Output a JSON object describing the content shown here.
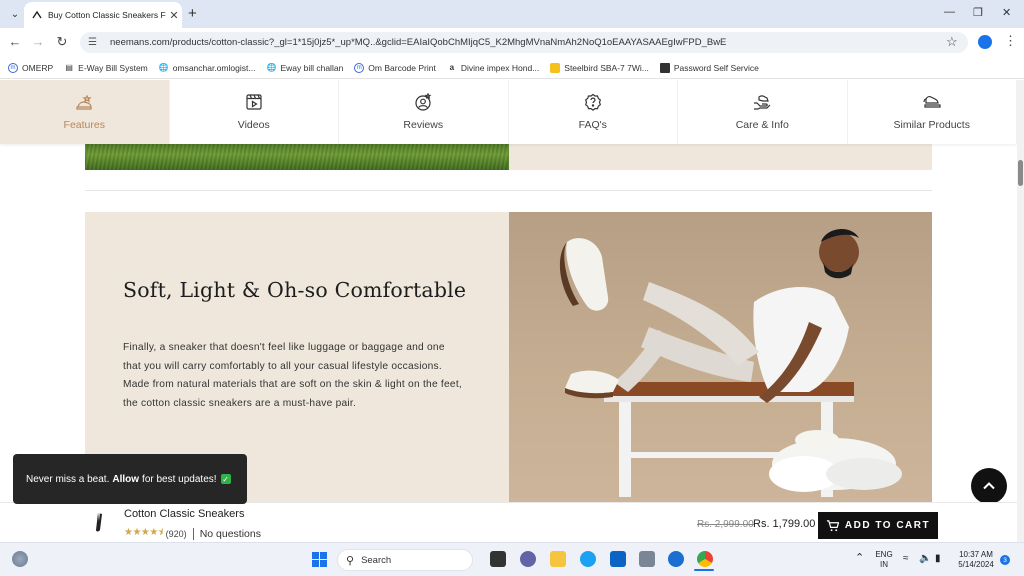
{
  "browser": {
    "tab_title": "Buy Cotton Classic Sneakers Fo",
    "url": "neemans.com/products/cotton-classic?_gl=1*15j0jz5*_up*MQ..&gclid=EAIaIQobChMIjqC5_K2MhgMVnaNmAh2NoQ1oEAAYASAAEgIwFPD_BwE",
    "bookmarks": [
      {
        "label": "OMERP",
        "icon": "omerp-icon"
      },
      {
        "label": "E-Way Bill System",
        "icon": "eway-icon"
      },
      {
        "label": "omsanchar.omlogist...",
        "icon": "globe-icon"
      },
      {
        "label": "Eway bill challan",
        "icon": "globe-icon"
      },
      {
        "label": "Om Barcode Print",
        "icon": "omerp-icon"
      },
      {
        "label": "Divine impex Hond...",
        "icon": "amazon-icon"
      },
      {
        "label": "Steelbird SBA-7 7Wi...",
        "icon": "steelbird-icon"
      },
      {
        "label": "Password Self Service",
        "icon": "pss-icon"
      }
    ]
  },
  "site_nav": {
    "tabs": [
      {
        "label": "Features",
        "icon": "features-icon",
        "active": true
      },
      {
        "label": "Videos",
        "icon": "videos-icon",
        "active": false
      },
      {
        "label": "Reviews",
        "icon": "reviews-icon",
        "active": false
      },
      {
        "label": "FAQ's",
        "icon": "faq-icon",
        "active": false
      },
      {
        "label": "Care & Info",
        "icon": "care-icon",
        "active": false
      },
      {
        "label": "Similar Products",
        "icon": "similar-icon",
        "active": false
      }
    ]
  },
  "feature": {
    "heading": "Soft, Light & Oh-so Comfortable",
    "paragraph": "Finally, a sneaker that doesn't feel like luggage or baggage and one that you will carry comfortably to all your casual lifestyle occasions. Made from natural materials that are soft on the skin & light on the feet, the cotton classic sneakers are a must-have pair."
  },
  "toast": {
    "prefix": "Never miss a beat.",
    "bold": "Allow",
    "suffix": "for best updates!"
  },
  "sticky_bar": {
    "product_name": "Cotton Classic Sneakers",
    "rating": 4.5,
    "review_count": "(920)",
    "questions": "No questions",
    "old_price": "Rs. 2,999.00",
    "new_price": "Rs. 1,799.00",
    "cart_label": "ADD TO CART"
  },
  "taskbar": {
    "search_placeholder": "Search",
    "lang_top": "ENG",
    "lang_bottom": "IN",
    "time": "10:37 AM",
    "date": "5/14/2024",
    "notification_count": "3"
  },
  "colors": {
    "accent": "#b8875a",
    "beige": "#efe7dc",
    "button": "#111111",
    "star": "#d4a84a"
  }
}
